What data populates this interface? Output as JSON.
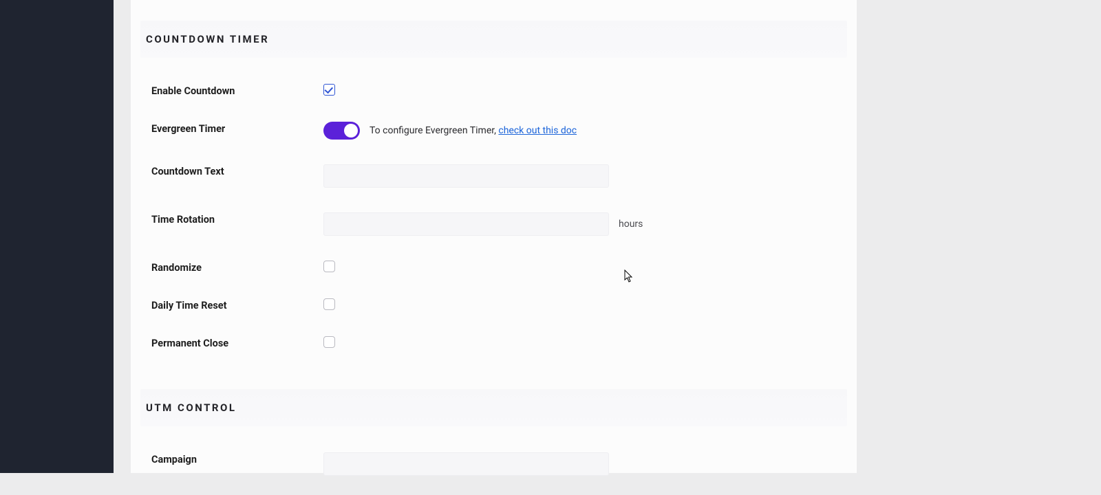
{
  "sections": {
    "countdown": {
      "title": "Countdown Timer",
      "fields": {
        "enable_countdown": {
          "label": "Enable Countdown",
          "checked": true
        },
        "evergreen_timer": {
          "label": "Evergreen Timer",
          "enabled": true,
          "hint_prefix": "To configure Evergreen Timer, ",
          "hint_link": "check out this doc"
        },
        "countdown_text": {
          "label": "Countdown Text",
          "value": ""
        },
        "time_rotation": {
          "label": "Time Rotation",
          "value": "",
          "suffix": "hours"
        },
        "randomize": {
          "label": "Randomize",
          "checked": false
        },
        "daily_time_reset": {
          "label": "Daily Time Reset",
          "checked": false
        },
        "permanent_close": {
          "label": "Permanent Close",
          "checked": false
        }
      }
    },
    "utm": {
      "title": "UTM Control",
      "fields": {
        "campaign": {
          "label": "Campaign",
          "value": ""
        }
      }
    }
  }
}
